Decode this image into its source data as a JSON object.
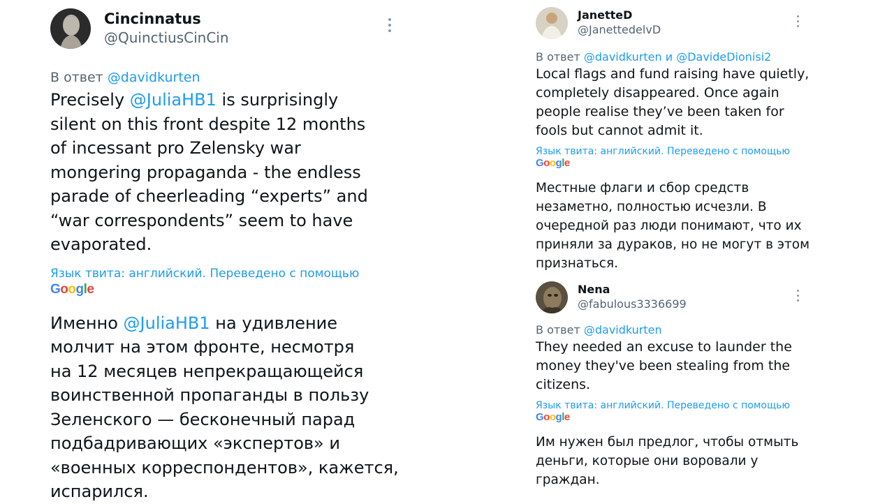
{
  "left_tweet": {
    "name": "Cincinnatus",
    "handle": "@QuinctiusCinCin",
    "reply_prefix": "В ответ ",
    "reply_to": "@davidkurten",
    "body_mention": "@JuliaHB1",
    "body_before": "Precisely ",
    "body_after": " is surprisingly\nsilent on this front despite 12 months\nof incessant pro Zelensky war\nmongering  propaganda - the endless\nparade of cheerleading “experts” and\n“war correspondents” seem to have\nevaporated.",
    "translate_label": "Язык твита: английский. Переведено с помощью",
    "translated_before": "Именно ",
    "translated_mention": "@JuliaHB1",
    "translated_after": " на удивление\nмолчит на этом фронте, несмотря\nна 12 месяцев непрекращающейся\nвоинственной пропаганды в пользу\nЗеленского — бесконечный парад\nподбадривающих «экспертов» и\n«военных корреспондентов», кажется,\nиспарился."
  },
  "right_tweet_1": {
    "name": "JanetteD",
    "handle": "@JanettedelvD",
    "reply_prefix": "В ответ ",
    "reply_to": "@davidkurten и @DavideDionisi2",
    "body": "Local flags and fund raising have quietly,\ncompletely disappeared. Once again\npeople realise they’ve been taken for\nfools but cannot admit it.",
    "translate_label": "Язык твита: английский. Переведено с помощью",
    "translated": "Местные флаги и сбор средств\nнезаметно, полностью исчезли. В\nочередной раз люди понимают, что их\nприняли за дураков, но не могут в этом\nпризнаться."
  },
  "right_tweet_2": {
    "name": "Nena",
    "handle": "@fabulous3336699",
    "reply_prefix": "В ответ ",
    "reply_to": "@davidkurten",
    "body": "They needed an excuse to launder the\nmoney they've been stealing from the\ncitizens.",
    "translate_label": "Язык твита: английский. Переведено с помощью",
    "translated": "Им нужен был предлог, чтобы отмыть\nденьги, которые они воровали у\nграждан."
  },
  "google": {
    "g1": "G",
    "o1": "o",
    "o2": "o",
    "g2": "g",
    "l": "l",
    "e": "e"
  },
  "icons": {
    "avatar_1": "roman-bust-avatar",
    "avatar_2": "person-avatar",
    "avatar_3": "animal-avatar",
    "more": "vertical-dots-icon"
  },
  "colors": {
    "link": "#1d9bf0",
    "muted": "#536471",
    "text": "#0f1419"
  }
}
